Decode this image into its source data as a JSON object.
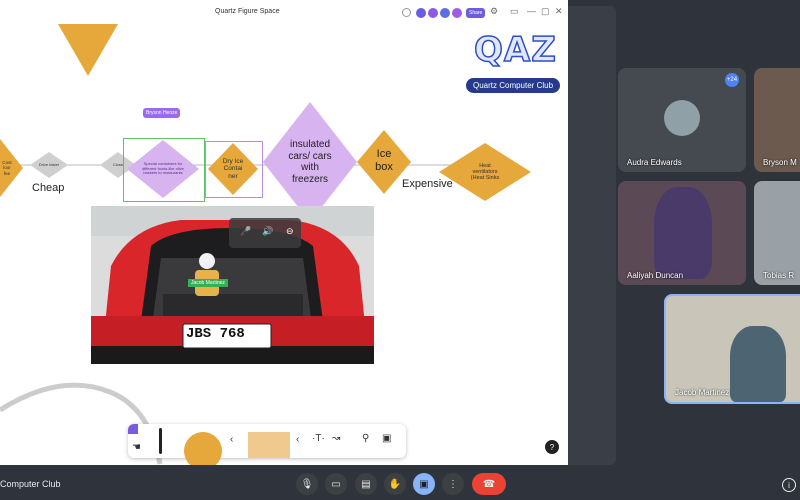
{
  "board": {
    "title": "Quartz Figure Space",
    "share_label": "Share",
    "user_tag": "Bryson Henze",
    "logo": "QAZ",
    "club_badge": "Quartz Computer Club",
    "flow": {
      "left_partial_text": "Cost\nloor\nfee",
      "d1": "Drive faster",
      "d2": "Close",
      "special": "Special containers for different foods like olive baskets to restaurants",
      "dry_ice": "Dry Ice\nContai\nner",
      "insulated": "insulated\ncars/ cars\nwith\nfreezers",
      "ice_box": "Ice\nbox",
      "heat": "Heat\nventilators\n(Heat Sinks"
    },
    "labels": {
      "cheap": "Cheap",
      "expensive": "Expensive"
    },
    "plate": "JBS 768",
    "car_tag": "Jacob Martinez",
    "help_icon": "help-icon",
    "colors": {
      "orange": "#e6a83a",
      "purple": "#d7b3ef",
      "gray": "#cfcfcf",
      "brand": "#2b4fc4"
    }
  },
  "participants": [
    {
      "name": "Audra Edwards"
    },
    {
      "name": "Bryson M"
    },
    {
      "name": "Aaliyah Duncan"
    },
    {
      "name": "Tobias R"
    },
    {
      "name": "Jacob Martinez"
    }
  ],
  "badge_count": "+24",
  "meeting_name": "Computer Club",
  "controls": [
    {
      "icon": "mic-icon"
    },
    {
      "icon": "camera-icon"
    },
    {
      "icon": "captions-icon"
    },
    {
      "icon": "raise-hand-icon"
    },
    {
      "icon": "present-icon"
    },
    {
      "icon": "more-icon"
    },
    {
      "icon": "end-call-icon"
    }
  ]
}
